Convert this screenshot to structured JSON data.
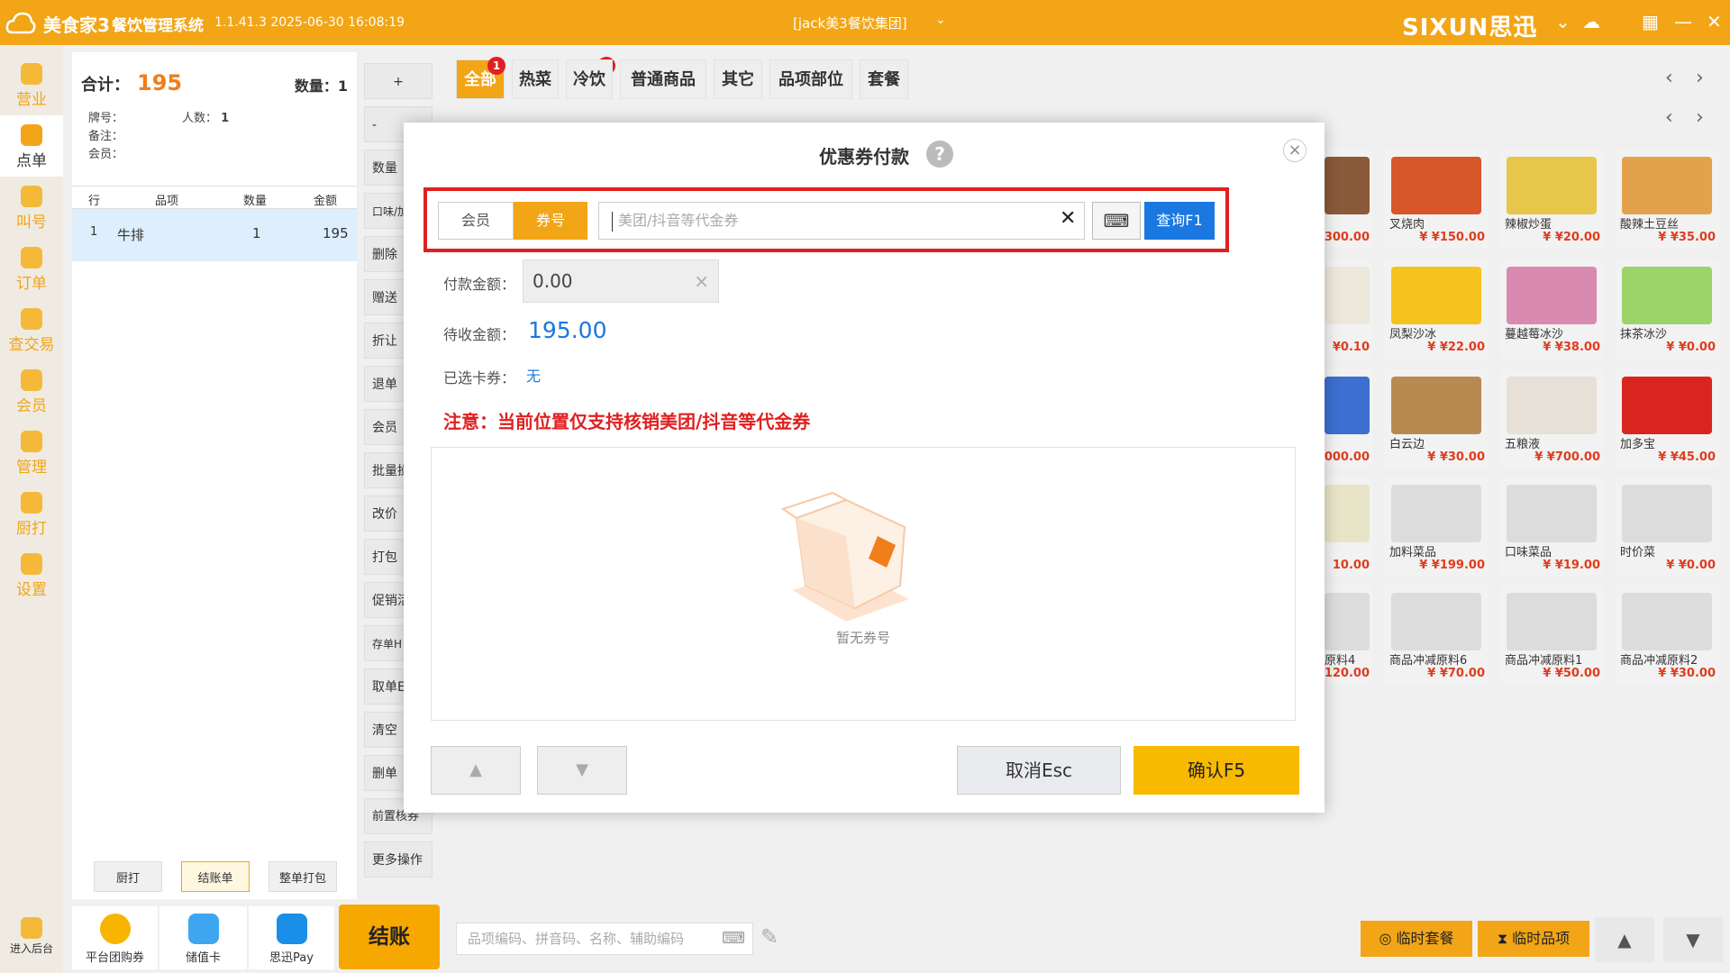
{
  "titlebar": {
    "brand": "美食家3",
    "system": "餐饮管理系统",
    "version": "1.1.41.3 2025-06-30 16:08:19",
    "group": "[jack美3餐饮集团]",
    "vendor": "SIXUN思迅",
    "bg_color": "#f2a516"
  },
  "nav": [
    {
      "label": "营业",
      "icon": "business-icon"
    },
    {
      "label": "点单",
      "icon": "hand-pointer-icon"
    },
    {
      "label": "叫号",
      "icon": "call-number-icon"
    },
    {
      "label": "订单",
      "icon": "order-icon"
    },
    {
      "label": "查交易",
      "icon": "search-transaction-icon"
    },
    {
      "label": "会员",
      "icon": "member-diamond-icon"
    },
    {
      "label": "管理",
      "icon": "manage-icon"
    },
    {
      "label": "厨打",
      "icon": "kitchen-print-icon"
    },
    {
      "label": "设置",
      "icon": "settings-icon"
    },
    {
      "label": "进入后台",
      "icon": "backend-icon"
    }
  ],
  "order": {
    "total_label": "合计：",
    "total_value": "195",
    "qty_label": "数量：",
    "qty_value": "1",
    "plate_label": "牌号：",
    "people_label": "人数：",
    "people_value": "1",
    "remark_label": "备注：",
    "member_label": "会员：",
    "columns": [
      "行",
      "品项",
      "数量",
      "金额"
    ],
    "rows": [
      {
        "line": "1",
        "item": "牛排",
        "qty": "1",
        "amount": "195"
      }
    ],
    "btn_kitchen": "厨打",
    "btn_bill": "结账单",
    "btn_pack": "整单打包"
  },
  "side_buttons": [
    "+",
    "-",
    "数量",
    "口味/加",
    "删除",
    "赠送",
    "折让",
    "退单",
    "会员",
    "批量操",
    "改价",
    "打包",
    "促销活",
    "存单H",
    "取单E",
    "清空",
    "删单",
    "前置核券",
    "更多操作"
  ],
  "pay_methods": [
    {
      "label": "平台团购券",
      "icon": "group-coupon-icon"
    },
    {
      "label": "储值卡",
      "icon": "stored-card-icon"
    },
    {
      "label": "思迅Pay",
      "icon": "pay-icon"
    }
  ],
  "checkout_label": "结账Enter",
  "categories": [
    {
      "label": "全部",
      "badge": "1"
    },
    {
      "label": "热菜",
      "badge": "1"
    },
    {
      "label": "冷饮",
      "badge": ""
    },
    {
      "label": "普通商品",
      "badge": ""
    },
    {
      "label": "其它",
      "badge": ""
    },
    {
      "label": "品项部位",
      "badge": ""
    },
    {
      "label": "套餐",
      "badge": ""
    }
  ],
  "products": [
    {
      "name": "",
      "price": "300.00"
    },
    {
      "name": "叉烧肉",
      "price": "¥ ¥150.00"
    },
    {
      "name": "辣椒炒蛋",
      "price": "¥ ¥20.00"
    },
    {
      "name": "酸辣土豆丝",
      "price": "¥ ¥35.00"
    },
    {
      "name": "",
      "price": "¥0.10"
    },
    {
      "name": "凤梨沙冰",
      "price": "¥ ¥22.00"
    },
    {
      "name": "蔓越莓冰沙",
      "price": "¥ ¥38.00"
    },
    {
      "name": "抹茶冰沙",
      "price": "¥ ¥0.00"
    },
    {
      "name": "",
      "price": "000.00"
    },
    {
      "name": "白云边",
      "price": "¥ ¥30.00"
    },
    {
      "name": "五粮液",
      "price": "¥ ¥700.00"
    },
    {
      "name": "加多宝",
      "price": "¥ ¥45.00"
    },
    {
      "name": "",
      "price": "10.00"
    },
    {
      "name": "加料菜品",
      "price": "¥ ¥199.00"
    },
    {
      "name": "口味菜品",
      "price": "¥ ¥19.00"
    },
    {
      "name": "时价菜",
      "price": "¥ ¥0.00"
    },
    {
      "name": "原料4",
      "price": "120.00"
    },
    {
      "name": "商品冲减原料6",
      "price": "¥ ¥70.00"
    },
    {
      "name": "商品冲减原料1",
      "price": "¥ ¥50.00"
    },
    {
      "name": "商品冲减原料2",
      "price": "¥ ¥30.00"
    }
  ],
  "dialog": {
    "title": "优惠券付款",
    "tab_member": "会员",
    "tab_coupon": "券号",
    "coupon_placeholder": "美团/抖音等代金券",
    "query_label": "查询F1",
    "pay_amount_label": "付款金额：",
    "pay_amount_value": "0.00",
    "due_label": "待收金额：",
    "due_value": "195.00",
    "chosen_label": "已选卡券：",
    "chosen_value": "无",
    "notice": "注意：当前位置仅支持核销美团/抖音等代金券",
    "empty_text": "暂无券号",
    "cancel_label": "取消Esc",
    "confirm_label": "确认F5"
  },
  "bottom": {
    "search_placeholder": "品项编码、拼音码、名称、辅助编码",
    "temp_set": "临时套餐",
    "temp_item": "临时品项"
  }
}
